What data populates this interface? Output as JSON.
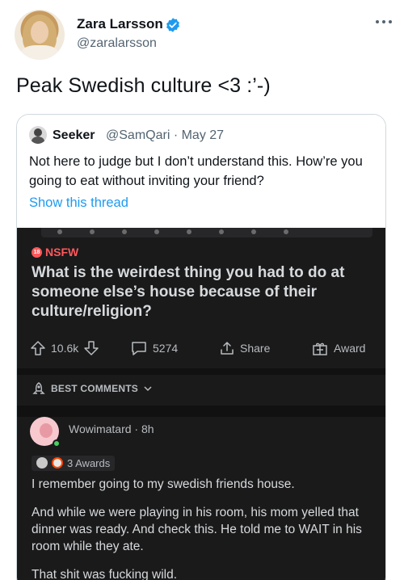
{
  "tweet": {
    "author_name": "Zara Larsson",
    "handle": "@zaralarsson",
    "text": "Peak Swedish culture <3 :’-)",
    "verified_color": "#1d9bf0"
  },
  "quote": {
    "author_name": "Seeker",
    "handle_date": "@SamQari · May 27",
    "text": "Not here to judge but I don’t understand this. How’re you going to eat without inviting your friend?",
    "link": "Show this thread",
    "link_color": "#1d9bf0"
  },
  "reddit": {
    "nsfw_badge": "18",
    "nsfw_label": "NSFW",
    "title": "What is the weirdest thing you had to do at someone else’s house because of their culture/religion?",
    "upvotes": "10.6k",
    "comments": "5274",
    "share": "Share",
    "award": "Award",
    "sort_label": "BEST COMMENTS",
    "comment": {
      "author": "Wowimatard · 8h",
      "awards": "3 Awards",
      "paragraphs": [
        "I remember going to my swedish friends house.",
        "And while we were playing in his room, his mom yelled that dinner was ready. And check this. He told me to WAIT in his room while they ate.",
        "That shit was fucking wild."
      ]
    }
  }
}
